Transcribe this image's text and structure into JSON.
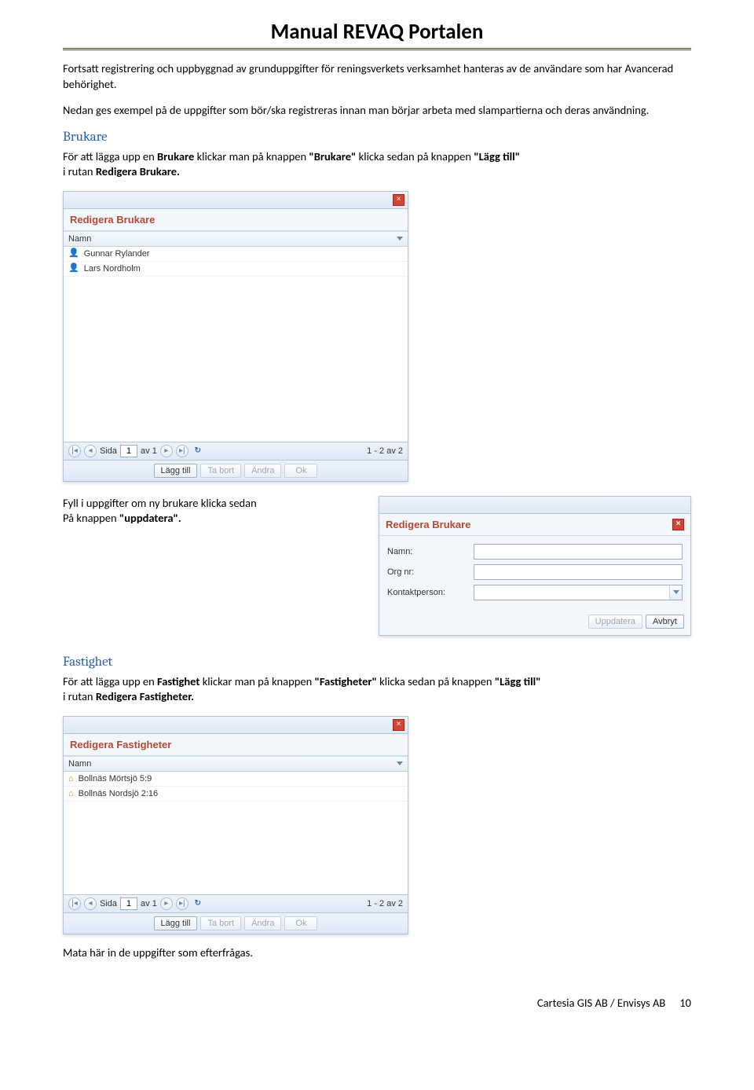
{
  "doc_title": "Manual REVAQ Portalen",
  "intro1": "Fortsatt registrering och uppbyggnad av grunduppgifter för reningsverkets verksamhet hanteras av de användare som har Avancerad behörighet.",
  "intro2": "Nedan ges exempel på de uppgifter som bör/ska registreras innan man börjar arbeta med slampartierna och deras användning.",
  "brukare": {
    "heading": "Brukare",
    "body_prefix": "För att lägga upp en ",
    "body_b1": "Brukare",
    "body_mid1": " klickar man på knappen ",
    "body_b2": "\"Brukare\"",
    "body_mid2": " klicka sedan på knappen ",
    "body_b3": "\"Lägg till\"",
    "body_mid3": " i rutan ",
    "body_b4": "Redigera Brukare.",
    "panel_title": "Redigera Brukare",
    "column": "Namn",
    "rows": [
      "Gunnar Rylander",
      "Lars Nordholm"
    ],
    "pager": {
      "side": "Sida",
      "cur": "1",
      "av": "av 1",
      "count": "1 - 2 av 2"
    },
    "buttons": {
      "add": "Lägg till",
      "del": "Ta bort",
      "edit": "Ändra",
      "ok": "Ok"
    },
    "close": "×"
  },
  "fill_text_1": "Fyll i uppgifter om ny brukare klicka sedan",
  "fill_text_2": "På knappen ",
  "fill_text_b": "\"uppdatera\".",
  "form": {
    "title": "Redigera Brukare",
    "labels": {
      "namn": "Namn:",
      "org": "Org nr:",
      "kontakt": "Kontaktperson:"
    },
    "buttons": {
      "upd": "Uppdatera",
      "cancel": "Avbryt"
    },
    "close": "×"
  },
  "fastighet": {
    "heading": "Fastighet",
    "body_prefix": "För att lägga upp en ",
    "body_b1": "Fastighet",
    "body_mid1": " klickar man på knappen ",
    "body_b2": "\"Fastigheter\"",
    "body_mid2": " klicka sedan på knappen ",
    "body_b3": "\"Lägg till\"",
    "body_mid3": " i rutan ",
    "body_b4": "Redigera Fastigheter.",
    "panel_title": "Redigera Fastigheter",
    "column": "Namn",
    "rows": [
      "Bollnäs Mörtsjö 5:9",
      "Bollnäs Nordsjö 2:16"
    ],
    "pager": {
      "side": "Sida",
      "cur": "1",
      "av": "av 1",
      "count": "1 - 2 av 2"
    },
    "buttons": {
      "add": "Lägg till",
      "del": "Ta bort",
      "edit": "Ändra",
      "ok": "Ok"
    },
    "close": "×"
  },
  "outro": "Mata här in de uppgifter som efterfrågas.",
  "footer": {
    "left": "Cartesia GIS AB  / Envisys AB",
    "page": "10"
  }
}
